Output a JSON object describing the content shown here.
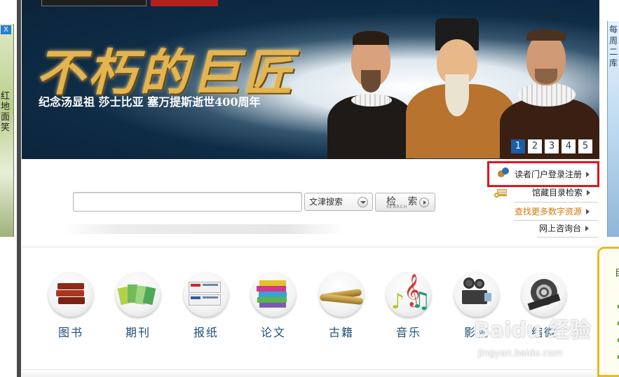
{
  "left_ad": {
    "close": "X",
    "vertical_text": "红地面笑"
  },
  "right_ad": {
    "vertical_text": "每周二库"
  },
  "banner": {
    "title": "不朽的巨匠",
    "subtitle": "纪念汤显祖 莎士比亚 塞万提斯逝世400周年",
    "pages": [
      "1",
      "2",
      "3",
      "4",
      "5"
    ],
    "active_page": "1"
  },
  "search": {
    "input_value": "",
    "type_select": "文津搜索",
    "button_label": "检 索",
    "button_sub": "SEARCH"
  },
  "quick_links": [
    {
      "label": "读者门户登录注册",
      "color": "#222222"
    },
    {
      "label": "馆藏目录检索",
      "color": "#222222"
    },
    {
      "label": "查找更多数字资源",
      "color": "#d07a0a"
    },
    {
      "label": "网上咨询台",
      "color": "#222222"
    }
  ],
  "categories": [
    {
      "label": "图书",
      "icon": "books-icon"
    },
    {
      "label": "期刊",
      "icon": "journals-icon"
    },
    {
      "label": "报纸",
      "icon": "newspaper-icon"
    },
    {
      "label": "论文",
      "icon": "papers-icon"
    },
    {
      "label": "古籍",
      "icon": "scrolls-icon"
    },
    {
      "label": "音乐",
      "icon": "music-notes-icon"
    },
    {
      "label": "影视",
      "icon": "film-projector-icon"
    },
    {
      "label": "缩微",
      "icon": "film-reel-icon"
    }
  ],
  "watermark": {
    "brand": "Baidu 经验",
    "url": "jingyan.baidu.com"
  },
  "colors": {
    "banner_bg": "#0f2c46",
    "title_gold": "#e3b44f",
    "pager_active": "#1b5ea8",
    "category_text": "#1d4f7a",
    "highlight_red": "#e3141b"
  }
}
